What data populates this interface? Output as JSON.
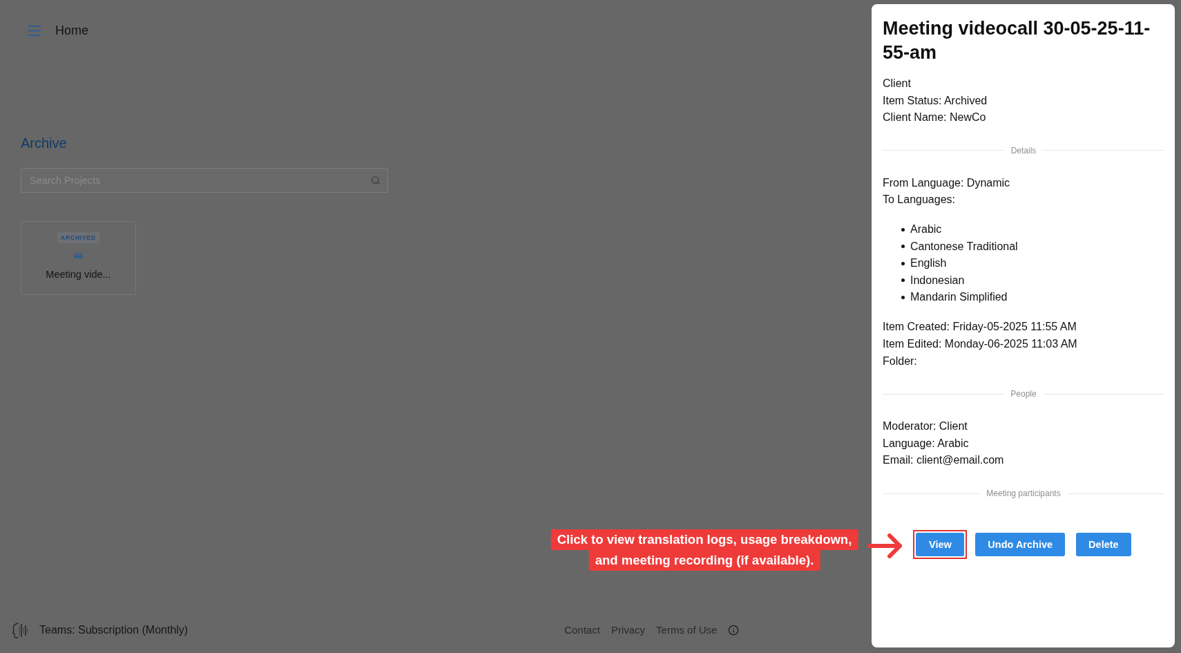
{
  "header": {
    "title": "Home"
  },
  "archive": {
    "heading": "Archive",
    "search": {
      "placeholder": "Search Projects"
    },
    "projects": [
      {
        "badge": "ARCHIVED",
        "name": "Meeting vide..."
      }
    ]
  },
  "drawer": {
    "title": "Meeting videocall 30-05-25-11-55-am",
    "blocks": [
      {
        "kind": "lines",
        "lines": [
          "Client",
          "Item Status: Archived",
          "Client Name: NewCo"
        ]
      },
      {
        "kind": "divider",
        "label": "Details"
      },
      {
        "kind": "lines",
        "lines": [
          "From Language: Dynamic",
          "To Languages:"
        ]
      },
      {
        "kind": "bullets",
        "items": [
          "Arabic",
          "Cantonese Traditional",
          "English",
          "Indonesian",
          "Mandarin Simplified"
        ]
      },
      {
        "kind": "lines",
        "lines": [
          "Item Created: Friday-05-2025 11:55 AM",
          "Item Edited: Monday-06-2025 11:03 AM",
          "Folder:"
        ]
      },
      {
        "kind": "divider",
        "label": "People"
      },
      {
        "kind": "lines",
        "lines": [
          "Moderator: Client",
          "Language: Arabic",
          "Email: client@email.com"
        ]
      },
      {
        "kind": "divider",
        "label": "Meeting participants"
      }
    ],
    "actions": [
      {
        "label": "View",
        "highlighted": true
      },
      {
        "label": "Undo Archive",
        "highlighted": false
      },
      {
        "label": "Delete",
        "highlighted": false
      }
    ]
  },
  "annotation": {
    "lines": [
      "Click to view translation logs, usage breakdown,",
      "and meeting recording (if available)."
    ]
  },
  "footer": {
    "plan": "Teams: Subscription (Monthly)",
    "links": [
      "Contact",
      "Privacy",
      "Terms of Use"
    ]
  }
}
